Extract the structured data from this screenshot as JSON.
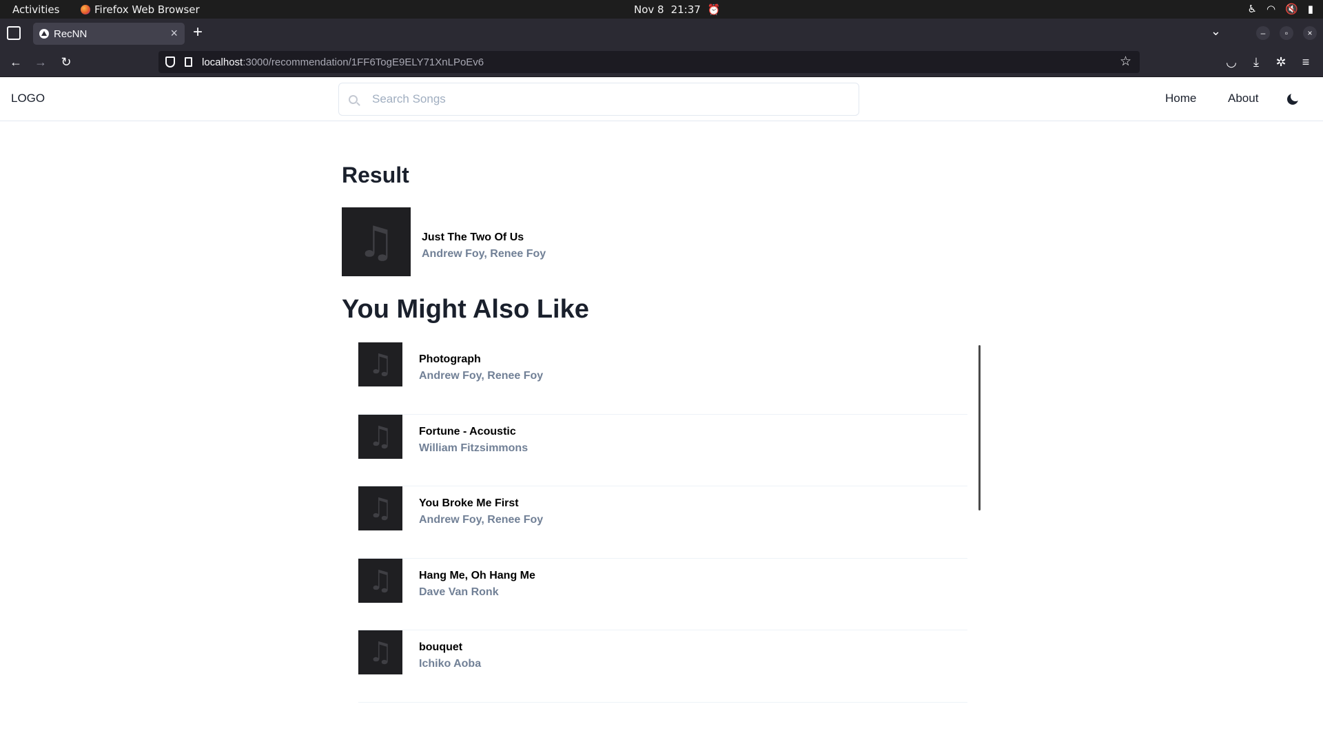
{
  "system": {
    "activities": "Activities",
    "app_name": "Firefox Web Browser",
    "date": "Nov 8",
    "time": "21:37"
  },
  "browser": {
    "tab_title": "RecNN",
    "url_host": "localhost",
    "url_path": ":3000/recommendation/1FF6TogE9ELY71XnLPoEv6"
  },
  "site": {
    "logo": "LOGO",
    "search_placeholder": "Search Songs",
    "nav": {
      "home": "Home",
      "about": "About"
    }
  },
  "result": {
    "heading": "Result",
    "song": {
      "title": "Just The Two Of Us",
      "artist": "Andrew Foy, Renee Foy"
    }
  },
  "recommendations": {
    "heading": "You Might Also Like",
    "items": [
      {
        "title": "Photograph",
        "artist": "Andrew Foy, Renee Foy"
      },
      {
        "title": "Fortune - Acoustic",
        "artist": "William Fitzsimmons"
      },
      {
        "title": "You Broke Me First",
        "artist": "Andrew Foy, Renee Foy"
      },
      {
        "title": "Hang Me, Oh Hang Me",
        "artist": "Dave Van Ronk"
      },
      {
        "title": "bouquet",
        "artist": "Ichiko Aoba"
      }
    ]
  }
}
